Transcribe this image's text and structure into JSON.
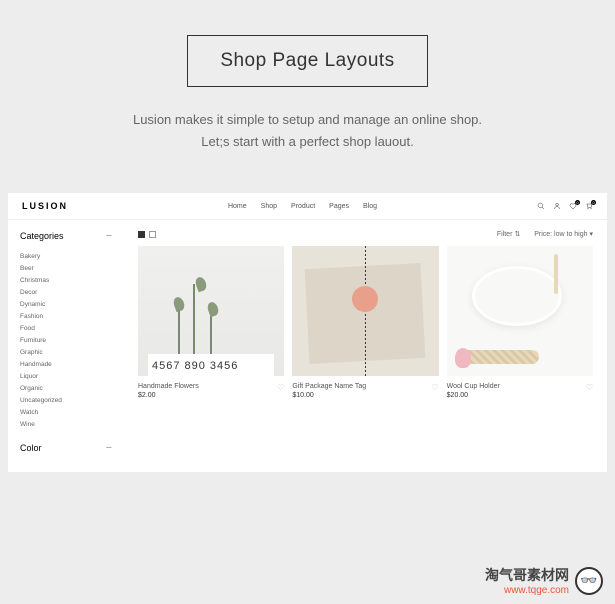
{
  "hero": {
    "title": "Shop Page Layouts",
    "subtitle_line1": "Lusion makes it simple to setup and manage an online shop.",
    "subtitle_line2": "Let;s start with a perfect shop lauout."
  },
  "shop": {
    "logo": "LUSION",
    "nav": [
      "Home",
      "Shop",
      "Product",
      "Pages",
      "Blog"
    ],
    "wishlist_count": "0",
    "cart_count": "0"
  },
  "sidebar": {
    "categories_title": "Categories",
    "categories": [
      "Bakery",
      "Beer",
      "Christmas",
      "Decor",
      "Dynamic",
      "Fashion",
      "Food",
      "Furniture",
      "Graphic",
      "Handmade",
      "Liquor",
      "Organic",
      "Uncategorized",
      "Watch",
      "Wine"
    ],
    "color_title": "Color"
  },
  "toolbar": {
    "filter_label": "Filter",
    "sort_label": "Price: low to high"
  },
  "products": [
    {
      "name": "Handmade Flowers",
      "price": "$2.00"
    },
    {
      "name": "Gift Package Name Tag",
      "price": "$10.00"
    },
    {
      "name": "Wool Cup Holder",
      "price": "$20.00"
    }
  ],
  "watermark": {
    "cn": "淘气哥素材网",
    "url": "www.tqge.com"
  }
}
